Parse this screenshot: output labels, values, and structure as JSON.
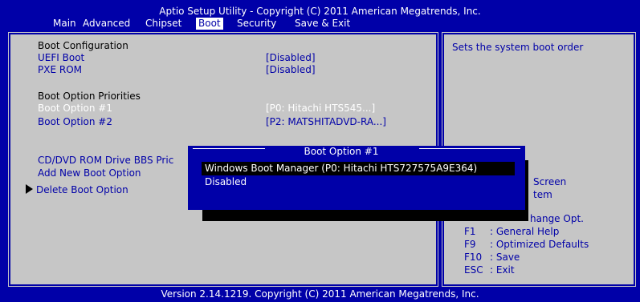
{
  "header": {
    "title": "Aptio Setup Utility - Copyright (C) 2011 American Megatrends, Inc."
  },
  "menu": {
    "tabs": [
      "Main",
      "Advanced",
      "Chipset",
      "Boot",
      "Security",
      "Save & Exit"
    ],
    "active": "Boot"
  },
  "main": {
    "boot_config_heading": "Boot Configuration",
    "uefi_boot_label": "UEFI Boot",
    "uefi_boot_value": "[Disabled]",
    "pxe_rom_label": "PXE ROM",
    "pxe_rom_value": "[Disabled]",
    "priorities_heading": "Boot Option Priorities",
    "boot_option_1_label": "Boot Option #1",
    "boot_option_1_value": "[P0:  Hitachi HTS545...]",
    "boot_option_2_label": "Boot Option #2",
    "boot_option_2_value": "[P2: MATSHITADVD-RA...]",
    "cd_dvd_label": "CD/DVD ROM Drive BBS Pric",
    "add_boot_label": "Add New Boot Option",
    "delete_boot_label": "Delete Boot Option"
  },
  "help": {
    "description": "Sets the system boot order",
    "partial_screen": "Screen",
    "partial_item": "tem",
    "partial_change": "hange Opt.",
    "keys": [
      {
        "key": "F1",
        "desc": ": General Help"
      },
      {
        "key": "F9",
        "desc": ": Optimized Defaults"
      },
      {
        "key": "F10",
        "desc": ": Save"
      },
      {
        "key": "ESC",
        "desc": ": Exit"
      }
    ]
  },
  "dialog": {
    "title": "Boot Option #1",
    "options": [
      "Windows Boot Manager (P0: Hitachi HTS727575A9E364)",
      "Disabled"
    ]
  },
  "footer": {
    "text": "Version 2.14.1219. Copyright (C) 2011 American Megatrends, Inc."
  },
  "colors": {
    "background": "#0000a8",
    "panel": "#c6c6c6",
    "text_blue": "#0000a8",
    "text_white": "#ffffff"
  }
}
